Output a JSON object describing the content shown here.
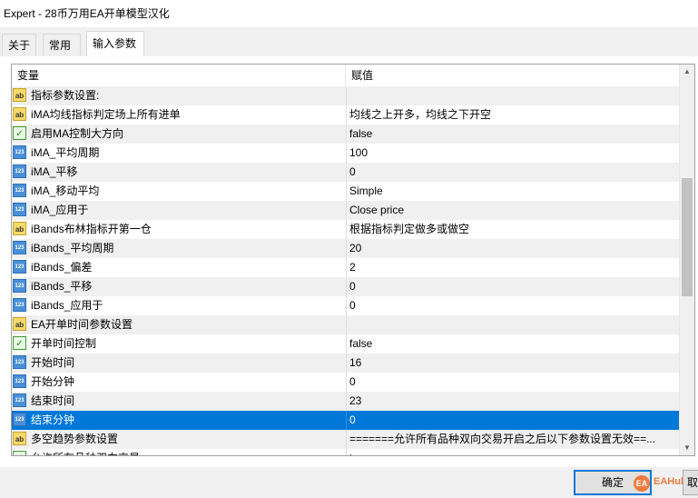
{
  "window": {
    "title": "Expert - 28币万用EA开单模型汉化"
  },
  "tabs": [
    {
      "label": "关于"
    },
    {
      "label": "常用"
    },
    {
      "label": "输入参数"
    }
  ],
  "grid": {
    "col_name": "变量",
    "col_value": "赋值",
    "rows": [
      {
        "type": "ab",
        "name": "指标参数设置:",
        "value": ""
      },
      {
        "type": "ab",
        "name": "iMA均线指标判定场上所有进单",
        "value": "均线之上开多，均线之下开空"
      },
      {
        "type": "bool",
        "name": "启用MA控制大方向",
        "value": "false"
      },
      {
        "type": "num",
        "name": "iMA_平均周期",
        "value": "100"
      },
      {
        "type": "num",
        "name": "iMA_平移",
        "value": "0"
      },
      {
        "type": "num",
        "name": "iMA_移动平均",
        "value": "Simple"
      },
      {
        "type": "num",
        "name": "iMA_应用于",
        "value": "Close price"
      },
      {
        "type": "ab",
        "name": "iBands布林指标开第一仓",
        "value": "根据指标判定做多或做空"
      },
      {
        "type": "num",
        "name": "iBands_平均周期",
        "value": "20"
      },
      {
        "type": "num",
        "name": "iBands_偏差",
        "value": "2"
      },
      {
        "type": "num",
        "name": "iBands_平移",
        "value": "0"
      },
      {
        "type": "num",
        "name": "iBands_应用于",
        "value": "0"
      },
      {
        "type": "ab",
        "name": "EA开单时间参数设置",
        "value": ""
      },
      {
        "type": "bool",
        "name": "开单时间控制",
        "value": "false"
      },
      {
        "type": "num",
        "name": "开始时间",
        "value": "16"
      },
      {
        "type": "num",
        "name": "开始分钟",
        "value": "0"
      },
      {
        "type": "num",
        "name": "结束时间",
        "value": "23"
      },
      {
        "type": "num",
        "name": "结束分钟",
        "value": "0",
        "selected": true
      },
      {
        "type": "ab",
        "name": "多空趋势参数设置",
        "value": "=======允许所有品种双向交易开启之后以下参数设置无效==..."
      },
      {
        "type": "bool",
        "name": "允许所有品种双向交易",
        "value": "true"
      }
    ]
  },
  "icons": {
    "ab": "ab",
    "num": "123",
    "bool": "✓"
  },
  "footer": {
    "ok_label": "确定",
    "cancel_label": "取",
    "watermark_badge": "EA",
    "watermark_text": "EAHub"
  },
  "colors": {
    "selection": "#0078d7",
    "alt_row": "#f0f0f0"
  }
}
